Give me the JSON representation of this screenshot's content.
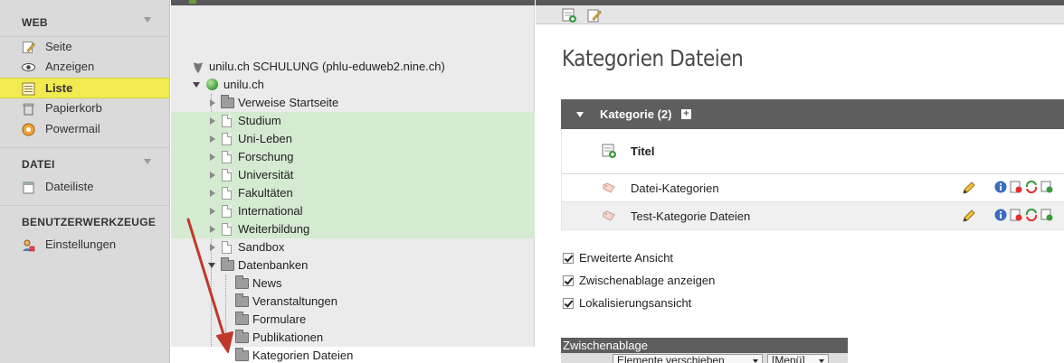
{
  "module_menu": {
    "groups": [
      {
        "title": "WEB",
        "items": [
          {
            "label": "Seite",
            "icon": "page-pencil-icon"
          },
          {
            "label": "Anzeigen",
            "icon": "eye-icon"
          },
          {
            "label": "Liste",
            "icon": "list-icon",
            "active": true
          },
          {
            "label": "Papierkorb",
            "icon": "trash-icon"
          },
          {
            "label": "Powermail",
            "icon": "powermail-icon"
          }
        ]
      },
      {
        "title": "DATEI",
        "items": [
          {
            "label": "Dateiliste",
            "icon": "file-list-icon"
          }
        ]
      },
      {
        "title": "BENUTZERWERKZEUGE",
        "items": [
          {
            "label": "Einstellungen",
            "icon": "user-settings-icon"
          }
        ]
      }
    ]
  },
  "page_tree": {
    "root": "unilu.ch SCHULUNG (phlu-eduweb2.nine.ch)",
    "site": "unilu.ch",
    "nodes": [
      "Verweise Startseite",
      "Studium",
      "Uni-Leben",
      "Forschung",
      "Universität",
      "Fakultäten",
      "International",
      "Weiterbildung",
      "Sandbox",
      "Datenbanken",
      "News",
      "Veranstaltungen",
      "Formulare",
      "Publikationen",
      "Kategorien Dateien"
    ]
  },
  "content": {
    "title": "Kategorien Dateien",
    "table": {
      "header": "Kategorie (2)",
      "column": "Titel",
      "rows": [
        "Datei-Kategorien",
        "Test-Kategorie Dateien"
      ]
    },
    "options": [
      "Erweiterte Ansicht",
      "Zwischenablage anzeigen",
      "Lokalisierungsansicht"
    ],
    "clipboard": {
      "title": "Zwischenablage",
      "action_select": "Elemente verschieben",
      "mode_select": "[Menü]"
    }
  },
  "colors": {
    "active_highlight": "#f1ea50",
    "tree_green": "#d4ead1",
    "table_header": "#5e5e5e",
    "arrow": "#c0392b"
  }
}
